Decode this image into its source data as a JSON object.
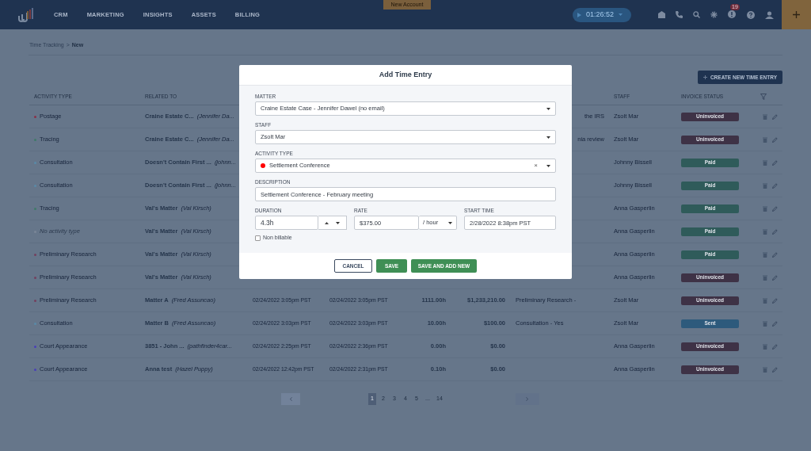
{
  "nav": {
    "items": [
      "CRM",
      "MARKETING",
      "INSIGHTS",
      "ASSETS",
      "BILLING"
    ],
    "account_tab": "New Account",
    "timer": "01:26:52",
    "alerts_count": "19"
  },
  "breadcrumb": {
    "parent": "Time Tracking",
    "separator": ">",
    "current": "New"
  },
  "create_button": "CREATE NEW TIME ENTRY",
  "table": {
    "columns": [
      "ACTIVITY TYPE",
      "RELATED TO",
      "STAFF",
      "INVOICE STATUS"
    ],
    "rows": [
      {
        "activity": {
          "label": "Postage",
          "color": "#8a3047",
          "muted": false
        },
        "matter": "Craine Estate C...",
        "contact": "(Jennifer Da...",
        "description": "the IRS",
        "description_cut": true,
        "staff": "Zsolt Mar",
        "status": {
          "label": "Uninvoiced",
          "color": "#3e3246"
        }
      },
      {
        "activity": {
          "label": "Tracing",
          "color": "#3f7a68",
          "muted": false
        },
        "matter": "Craine Estate C...",
        "contact": "(Jennifer Da...",
        "description": "nia review",
        "description_cut": true,
        "staff": "Zsolt Mar",
        "status": {
          "label": "Uninvoiced",
          "color": "#3e3246"
        }
      },
      {
        "activity": {
          "label": "Consultation",
          "color": "#5a8aa8",
          "muted": false
        },
        "matter": "Doesn't Contain First ...",
        "contact": "(johnn...",
        "staff": "Johnny Bissell",
        "status": {
          "label": "Paid",
          "color": "#2f5b5a"
        }
      },
      {
        "activity": {
          "label": "Consultation",
          "color": "#5a8aa8",
          "muted": false
        },
        "matter": "Doesn't Contain First ...",
        "contact": "(johnn...",
        "staff": "Johnny Bissell",
        "status": {
          "label": "Paid",
          "color": "#2f5b5a"
        }
      },
      {
        "activity": {
          "label": "Tracing",
          "color": "#3f7a68",
          "muted": false
        },
        "matter": "Val's Matter",
        "contact": "(Val Kirsch)",
        "staff": "Anna Gasperlin",
        "status": {
          "label": "Paid",
          "color": "#2f5b5a"
        }
      },
      {
        "activity": {
          "label": "No activity type",
          "color": "#7a8798",
          "muted": true
        },
        "matter": "Val's Matter",
        "contact": "(Val Kirsch)",
        "staff": "Anna Gasperlin",
        "status": {
          "label": "Paid",
          "color": "#2f5b5a"
        }
      },
      {
        "activity": {
          "label": "Preliminary Research",
          "color": "#74405e",
          "muted": false
        },
        "matter": "Val's Matter",
        "contact": "(Val Kirsch)",
        "staff": "Anna Gasperlin",
        "status": {
          "label": "Paid",
          "color": "#2f5b5a"
        }
      },
      {
        "activity": {
          "label": "Preliminary Research",
          "color": "#74405e",
          "muted": false
        },
        "matter": "Val's Matter",
        "contact": "(Val Kirsch)",
        "staff": "Anna Gasperlin",
        "status": {
          "label": "Uninvoiced",
          "color": "#3e3246"
        }
      },
      {
        "activity": {
          "label": "Preliminary Research",
          "color": "#74405e",
          "muted": false
        },
        "matter": "Matter A",
        "contact": "(Fred Assuncao)",
        "start": "02/24/2022 3:05pm PST",
        "end": "02/24/2022 3:05pm PST",
        "duration": "1111.00h",
        "amount": "$1,233,210.00",
        "description": "Preliminary Research -",
        "description_cut": false,
        "staff": "Zsolt Mar",
        "status": {
          "label": "Uninvoiced",
          "color": "#3e3246"
        }
      },
      {
        "activity": {
          "label": "Consultation",
          "color": "#5a8aa8",
          "muted": false
        },
        "matter": "Matter B",
        "contact": "(Fred Assuncao)",
        "start": "02/24/2022 3:03pm PST",
        "end": "02/24/2022 3:03pm PST",
        "duration": "10.00h",
        "amount": "$100.00",
        "description": "Consultation - Yes",
        "description_cut": false,
        "staff": "Zsolt Mar",
        "status": {
          "label": "Sent",
          "color": "#2d5a7c"
        }
      },
      {
        "activity": {
          "label": "Court Appearance",
          "color": "#4a3fb8",
          "muted": false
        },
        "matter": "3851 - John ...",
        "contact": "(pathfinder4car...",
        "start": "02/24/2022 2:25pm PST",
        "end": "02/24/2022 2:36pm PST",
        "duration": "0.00h",
        "amount": "$0.00",
        "staff": "Anna Gasperlin",
        "status": {
          "label": "Uninvoiced",
          "color": "#3e3246"
        }
      },
      {
        "activity": {
          "label": "Court Appearance",
          "color": "#4a3fb8",
          "muted": false
        },
        "matter": "Anna test",
        "contact": "(Hazel Puppy)",
        "start": "02/24/2022 12:42pm PST",
        "end": "02/24/2022 2:31pm PST",
        "duration": "0.10h",
        "amount": "$0.00",
        "staff": "Anna Gasperlin",
        "status": {
          "label": "Uninvoiced",
          "color": "#3e3246"
        }
      }
    ]
  },
  "pagination": {
    "pages": [
      {
        "label": "1",
        "selected": true
      },
      {
        "label": "2",
        "selected": false
      },
      {
        "label": "3",
        "selected": false
      },
      {
        "label": "4",
        "selected": false
      },
      {
        "label": "5",
        "selected": false
      },
      {
        "label": "...",
        "selected": false
      },
      {
        "label": "14",
        "selected": false
      }
    ]
  },
  "dialog": {
    "title": "Add Time Entry",
    "matter": {
      "label": "MATTER",
      "value": "Craine Estate Case - Jennifer Dawel (no email)"
    },
    "staff": {
      "label": "STAFF",
      "value": "Zsolt Mar"
    },
    "activity_type": {
      "label": "ACTIVITY TYPE",
      "value": "Settlement Conference",
      "color": "#ff0000",
      "clear": "×"
    },
    "description": {
      "label": "DESCRIPTION",
      "value": "Settlement Conference - February meeting"
    },
    "duration": {
      "label": "DURATION",
      "value": "4.3h"
    },
    "rate": {
      "label": "RATE",
      "value": "$375.00",
      "unit": "/ hour"
    },
    "start_time": {
      "label": "START TIME",
      "value": "2/28/2022 8:38pm PST"
    },
    "non_billable": {
      "label": "Non billable",
      "checked": false
    },
    "buttons": {
      "cancel": "CANCEL",
      "save": "SAVE",
      "save_new": "SAVE AND ADD NEW"
    }
  }
}
